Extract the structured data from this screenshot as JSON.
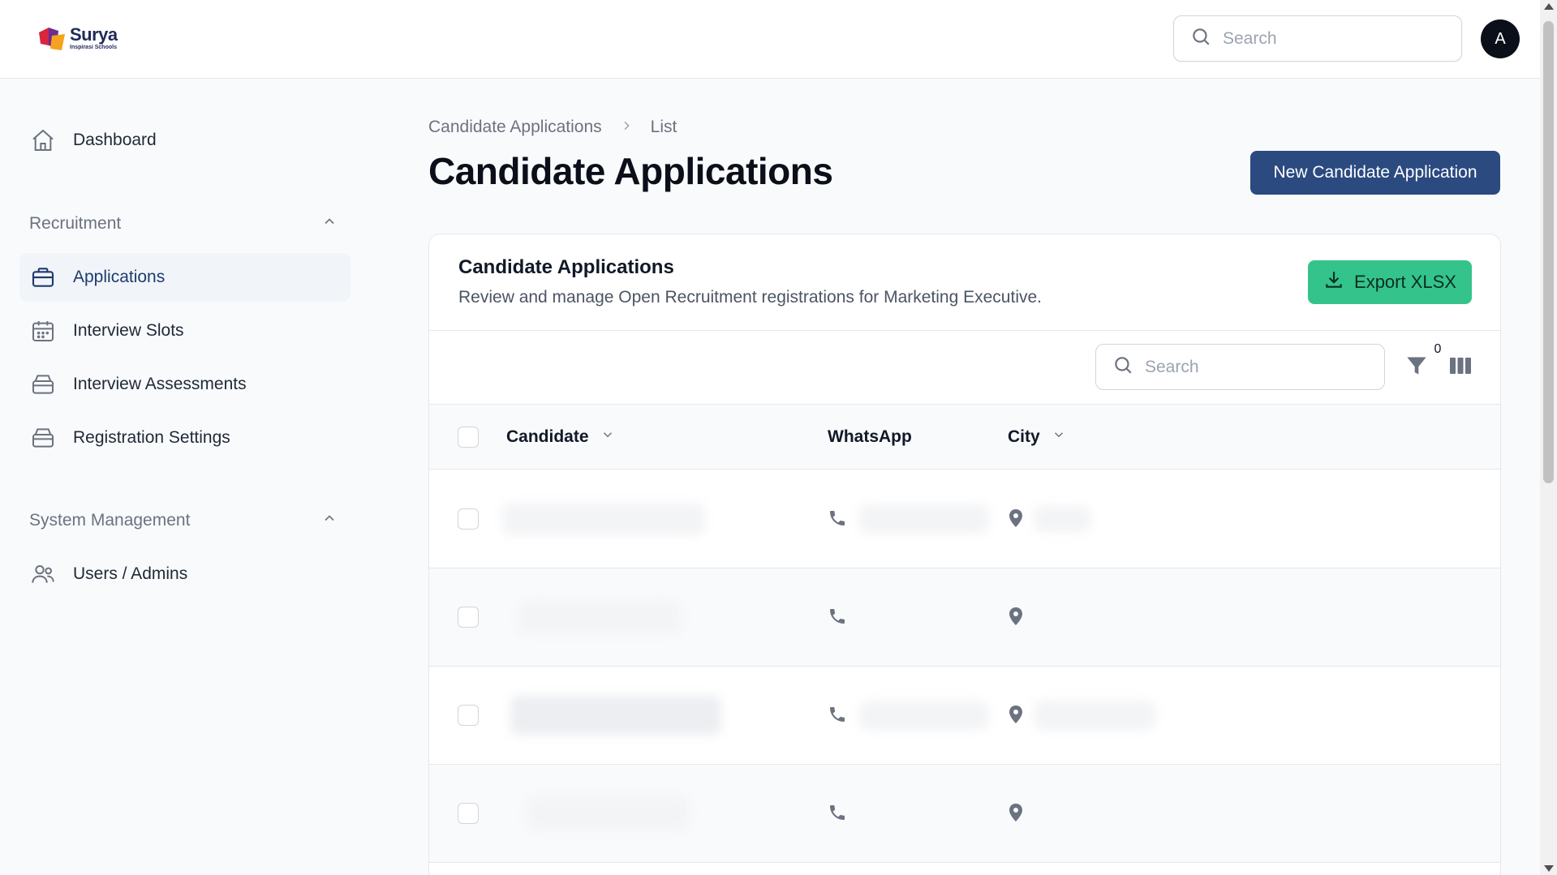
{
  "app": {
    "logo_name": "Surya",
    "logo_sub": "Inspirasi Schools",
    "brand_colors": {
      "primary": "#2a4a80",
      "export": "#34c48b",
      "logo_red": "#d7263d",
      "logo_orange": "#f6a21e",
      "logo_purple": "#6b2d8f"
    }
  },
  "topbar": {
    "search_placeholder": "Search",
    "avatar_initial": "A"
  },
  "sidebar": {
    "dashboard": {
      "label": "Dashboard",
      "icon": "home-icon"
    },
    "recruitment": {
      "label": "Recruitment",
      "items": [
        {
          "label": "Applications",
          "icon": "briefcase-icon",
          "active": true
        },
        {
          "label": "Interview Slots",
          "icon": "calendar-icon",
          "active": false
        },
        {
          "label": "Interview Assessments",
          "icon": "inbox-icon",
          "active": false
        },
        {
          "label": "Registration Settings",
          "icon": "inbox-icon",
          "active": false
        }
      ]
    },
    "system": {
      "label": "System Management",
      "items": [
        {
          "label": "Users / Admins",
          "icon": "users-icon",
          "active": false
        }
      ]
    }
  },
  "main": {
    "breadcrumb": [
      "Candidate Applications",
      "List"
    ],
    "title": "Candidate Applications",
    "new_button": "New Candidate Application"
  },
  "card": {
    "title": "Candidate Applications",
    "description": "Review and manage Open Recruitment registrations for Marketing Executive.",
    "export_button": "Export XLSX",
    "search_placeholder": "Search",
    "filter_count": "0",
    "columns": [
      {
        "label": "Candidate",
        "sortable": true
      },
      {
        "label": "WhatsApp",
        "sortable": false
      },
      {
        "label": "City",
        "sortable": true
      }
    ],
    "rows_loading": 4
  }
}
